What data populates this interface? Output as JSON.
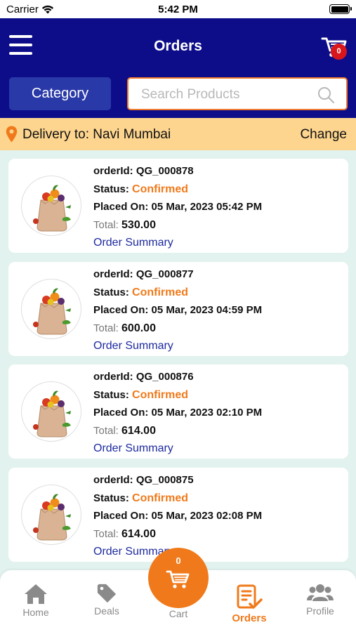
{
  "status_bar": {
    "carrier": "Carrier",
    "time": "5:42 PM"
  },
  "header": {
    "title": "Orders",
    "cart_count": "0",
    "category_label": "Category",
    "search_placeholder": "Search Products"
  },
  "delivery": {
    "label": "Delivery to: Navi Mumbai",
    "change_label": "Change"
  },
  "order_labels": {
    "order_id": "orderId:",
    "status": "Status:",
    "placed_on": "Placed On:",
    "total": "Total:",
    "summary": "Order Summary"
  },
  "orders": [
    {
      "id": "QG_000878",
      "status": "Confirmed",
      "placed_on": "05 Mar, 2023 05:42 PM",
      "total": "530.00"
    },
    {
      "id": "QG_000877",
      "status": "Confirmed",
      "placed_on": "05 Mar, 2023 04:59 PM",
      "total": "600.00"
    },
    {
      "id": "QG_000876",
      "status": "Confirmed",
      "placed_on": "05 Mar, 2023 02:10 PM",
      "total": "614.00"
    },
    {
      "id": "QG_000875",
      "status": "Confirmed",
      "placed_on": "05 Mar, 2023 02:08 PM",
      "total": "614.00"
    }
  ],
  "tabbar": {
    "home": "Home",
    "deals": "Deals",
    "cart": "Cart",
    "cart_count": "0",
    "orders": "Orders",
    "profile": "Profile"
  },
  "colors": {
    "header_bg": "#0d0d8a",
    "accent_orange": "#f07a1b",
    "delivery_bg": "#fdd58f",
    "link_blue": "#1d2a9e",
    "badge_red": "#d9161c"
  },
  "icons": [
    "wifi-icon",
    "battery-icon",
    "menu-icon",
    "cart-icon",
    "search-icon",
    "location-pin-icon",
    "grocery-bag-icon",
    "home-icon",
    "tag-icon",
    "orders-icon",
    "profile-icon"
  ]
}
